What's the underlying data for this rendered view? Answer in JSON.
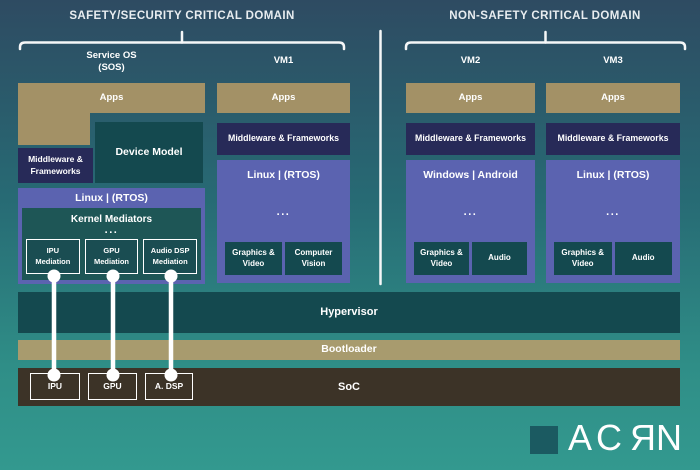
{
  "header": {
    "left_domain": "SAFETY/SECURITY CRITICAL DOMAIN",
    "right_domain": "NON-SAFETY CRITICAL DOMAIN"
  },
  "columns": {
    "sos": {
      "label_line1": "Service OS",
      "label_line2": "(SOS)",
      "apps_label": "Apps",
      "device_model_label": "Device Model",
      "middleware_line1": "Middleware &",
      "middleware_line2": "Frameworks",
      "os_label": "Linux | (RTOS)",
      "kernel_mediators_label": "Kernel Mediators",
      "ellipsis": "...",
      "mediators": [
        {
          "line1": "IPU",
          "line2": "Mediation"
        },
        {
          "line1": "GPU",
          "line2": "Mediation"
        },
        {
          "line1": "Audio DSP",
          "line2": "Mediation"
        }
      ]
    },
    "vm1": {
      "label": "VM1",
      "apps_label": "Apps",
      "middleware_label": "Middleware & Frameworks",
      "os_label": "Linux | (RTOS)",
      "ellipsis": "...",
      "services": [
        {
          "lines": [
            "Graphics &",
            "Video"
          ]
        },
        {
          "lines": [
            "Computer",
            "Vision"
          ]
        }
      ]
    },
    "vm2": {
      "label": "VM2",
      "apps_label": "Apps",
      "middleware_label": "Middleware & Frameworks",
      "os_label": "Windows | Android",
      "ellipsis": "...",
      "services": [
        {
          "lines": [
            "Graphics &",
            "Video"
          ]
        },
        {
          "lines": [
            "Audio"
          ]
        }
      ]
    },
    "vm3": {
      "label": "VM3",
      "apps_label": "Apps",
      "middleware_label": "Middleware & Frameworks",
      "os_label": "Linux | (RTOS)",
      "ellipsis": "...",
      "services": [
        {
          "lines": [
            "Graphics &",
            "Video"
          ]
        },
        {
          "lines": [
            "Audio"
          ]
        }
      ]
    }
  },
  "platform": {
    "hypervisor_label": "Hypervisor",
    "bootloader_label": "Bootloader",
    "soc_label": "SoC",
    "soc_components": [
      "IPU",
      "GPU",
      "A. DSP"
    ]
  },
  "logo": {
    "pre": "AC",
    "mirrored_letter": "R",
    "post": "N"
  },
  "colors": {
    "background_top": "#2e4b62",
    "background_bottom": "#33998f",
    "apps_tan": "#a39166",
    "bootloader_tan": "#a89b6e",
    "middleware_navy": "#272a58",
    "os_purple": "#5b63b0",
    "teal_box": "#14494f",
    "kernel_mediators_teal": "#1e5656",
    "soc_brown": "#3c3327",
    "logo_square_teal": "#1b5a61",
    "connector_white": "#ffffff"
  }
}
